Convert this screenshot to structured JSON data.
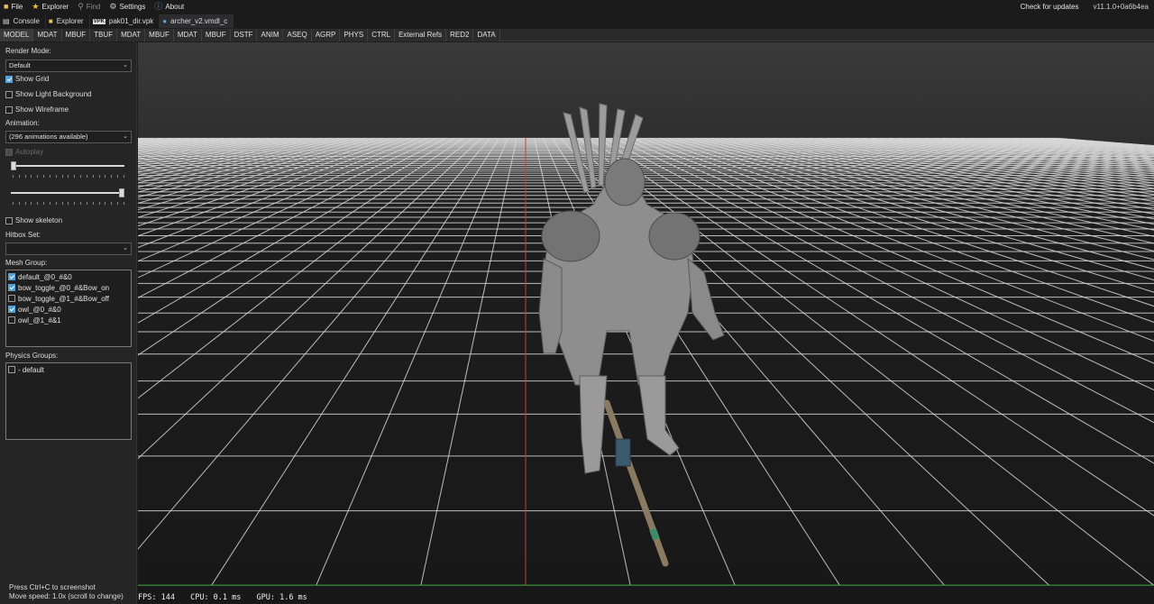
{
  "menu": {
    "items": [
      {
        "label": "File",
        "icon": "folder-icon",
        "disabled": false
      },
      {
        "label": "Explorer",
        "icon": "star-icon",
        "disabled": false
      },
      {
        "label": "Find",
        "icon": "search-icon",
        "disabled": true
      },
      {
        "label": "Settings",
        "icon": "gear-icon",
        "disabled": false
      },
      {
        "label": "About",
        "icon": "info-icon",
        "disabled": false
      }
    ],
    "check_updates": "Check for updates",
    "version": "v11.1.0+0a6b4ea"
  },
  "doc_tabs": [
    {
      "label": "Console",
      "icon": "console-icon",
      "active": false
    },
    {
      "label": "Explorer",
      "icon": "folder-icon",
      "active": false
    },
    {
      "label": "pak01_dir.vpk",
      "icon": "vpk-icon",
      "active": false
    },
    {
      "label": "archer_v2.vmdl_c",
      "icon": "model-icon",
      "active": true
    }
  ],
  "resource_tabs": [
    "MODEL",
    "MDAT",
    "MBUF",
    "TBUF",
    "MDAT",
    "MBUF",
    "MDAT",
    "MBUF",
    "DSTF",
    "ANIM",
    "ASEQ",
    "AGRP",
    "PHYS",
    "CTRL",
    "External Refs",
    "RED2",
    "DATA"
  ],
  "resource_tab_active": 0,
  "sidebar": {
    "render_mode_label": "Render Mode:",
    "render_mode_value": "Default",
    "show_grid": {
      "label": "Show Grid",
      "checked": true
    },
    "show_light_bg": {
      "label": "Show Light Background",
      "checked": false
    },
    "show_wireframe": {
      "label": "Show Wireframe",
      "checked": false
    },
    "animation_label": "Animation:",
    "animation_value": "(296 animations available)",
    "autoplay": {
      "label": "Autoplay",
      "checked": true,
      "disabled": true
    },
    "animation_frame_level": 0.0,
    "animation_speed_level": 1.0,
    "show_skeleton": {
      "label": "Show skeleton",
      "checked": false
    },
    "hitbox_label": "Hitbox Set:",
    "hitbox_value": "",
    "mesh_group_label": "Mesh Group:",
    "mesh_groups": [
      {
        "label": "default_@0_#&0",
        "checked": true
      },
      {
        "label": "bow_toggle_@0_#&Bow_on",
        "checked": true
      },
      {
        "label": "bow_toggle_@1_#&Bow_off",
        "checked": false
      },
      {
        "label": "owl_@0_#&0",
        "checked": true
      },
      {
        "label": "owl_@1_#&1",
        "checked": false
      }
    ],
    "physics_label": "Physics Groups:",
    "physics_groups": [
      {
        "label": "- default",
        "checked": false
      }
    ],
    "footer_line1": "Press Ctrl+C to screenshot",
    "footer_line2": "Move speed: 1.0x (scroll to change)"
  },
  "viewport": {
    "fps": "FPS: 144",
    "cpu": "CPU: 0.1 ms",
    "gpu": "GPU: 1.6 ms",
    "colors": {
      "grid": "#d9d9d9",
      "axis_x": "#d03a3a",
      "axis_y": "#3fae3f",
      "model": "#8c8c8c"
    }
  }
}
